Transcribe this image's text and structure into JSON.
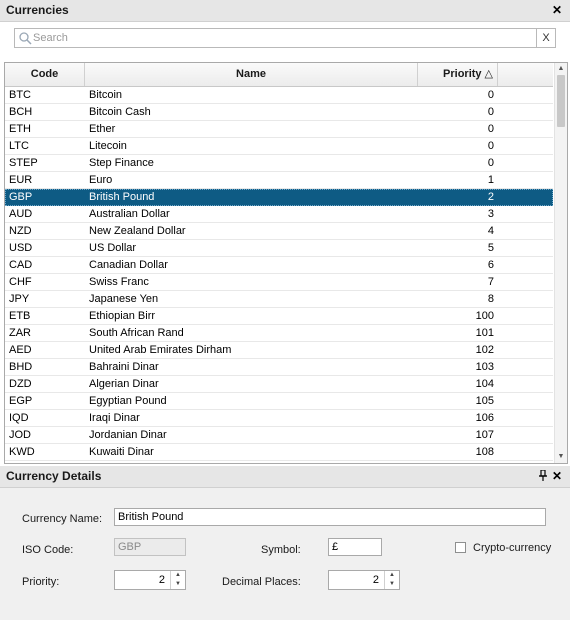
{
  "currencies_panel": {
    "title": "Currencies",
    "close_icon": "✕",
    "search": {
      "placeholder": "Search",
      "value": "",
      "clear_label": "X"
    }
  },
  "grid": {
    "columns": {
      "code": "Code",
      "name": "Name",
      "priority": "Priority",
      "sort_indicator": "△"
    },
    "selected_code": "GBP",
    "rows": [
      {
        "code": "BTC",
        "name": "Bitcoin",
        "priority": "0"
      },
      {
        "code": "BCH",
        "name": "Bitcoin Cash",
        "priority": "0"
      },
      {
        "code": "ETH",
        "name": "Ether",
        "priority": "0"
      },
      {
        "code": "LTC",
        "name": "Litecoin",
        "priority": "0"
      },
      {
        "code": "STEP",
        "name": "Step Finance",
        "priority": "0"
      },
      {
        "code": "EUR",
        "name": "Euro",
        "priority": "1"
      },
      {
        "code": "GBP",
        "name": "British Pound",
        "priority": "2"
      },
      {
        "code": "AUD",
        "name": "Australian Dollar",
        "priority": "3"
      },
      {
        "code": "NZD",
        "name": "New Zealand Dollar",
        "priority": "4"
      },
      {
        "code": "USD",
        "name": "US Dollar",
        "priority": "5"
      },
      {
        "code": "CAD",
        "name": "Canadian Dollar",
        "priority": "6"
      },
      {
        "code": "CHF",
        "name": "Swiss Franc",
        "priority": "7"
      },
      {
        "code": "JPY",
        "name": "Japanese Yen",
        "priority": "8"
      },
      {
        "code": "ETB",
        "name": "Ethiopian Birr",
        "priority": "100"
      },
      {
        "code": "ZAR",
        "name": "South African Rand",
        "priority": "101"
      },
      {
        "code": "AED",
        "name": "United Arab Emirates Dirham",
        "priority": "102"
      },
      {
        "code": "BHD",
        "name": "Bahraini Dinar",
        "priority": "103"
      },
      {
        "code": "DZD",
        "name": "Algerian Dinar",
        "priority": "104"
      },
      {
        "code": "EGP",
        "name": "Egyptian Pound",
        "priority": "105"
      },
      {
        "code": "IQD",
        "name": "Iraqi Dinar",
        "priority": "106"
      },
      {
        "code": "JOD",
        "name": "Jordanian Dinar",
        "priority": "107"
      },
      {
        "code": "KWD",
        "name": "Kuwaiti Dinar",
        "priority": "108"
      }
    ]
  },
  "details_panel": {
    "title": "Currency Details",
    "pin_icon": "📌",
    "close_icon": "✕",
    "currency_name_label": "Currency Name:",
    "currency_name_value": "British Pound",
    "iso_code_label": "ISO Code:",
    "iso_code_value": "GBP",
    "symbol_label": "Symbol:",
    "symbol_value": "£",
    "crypto_label": "Crypto-currency",
    "crypto_checked": false,
    "priority_label": "Priority:",
    "priority_value": "2",
    "decimal_places_label": "Decimal Places:",
    "decimal_places_value": "2"
  },
  "colors": {
    "selection": "#0e5b84",
    "header_bg": "#e6e6e6",
    "panel_bg": "#f0f0f0"
  }
}
